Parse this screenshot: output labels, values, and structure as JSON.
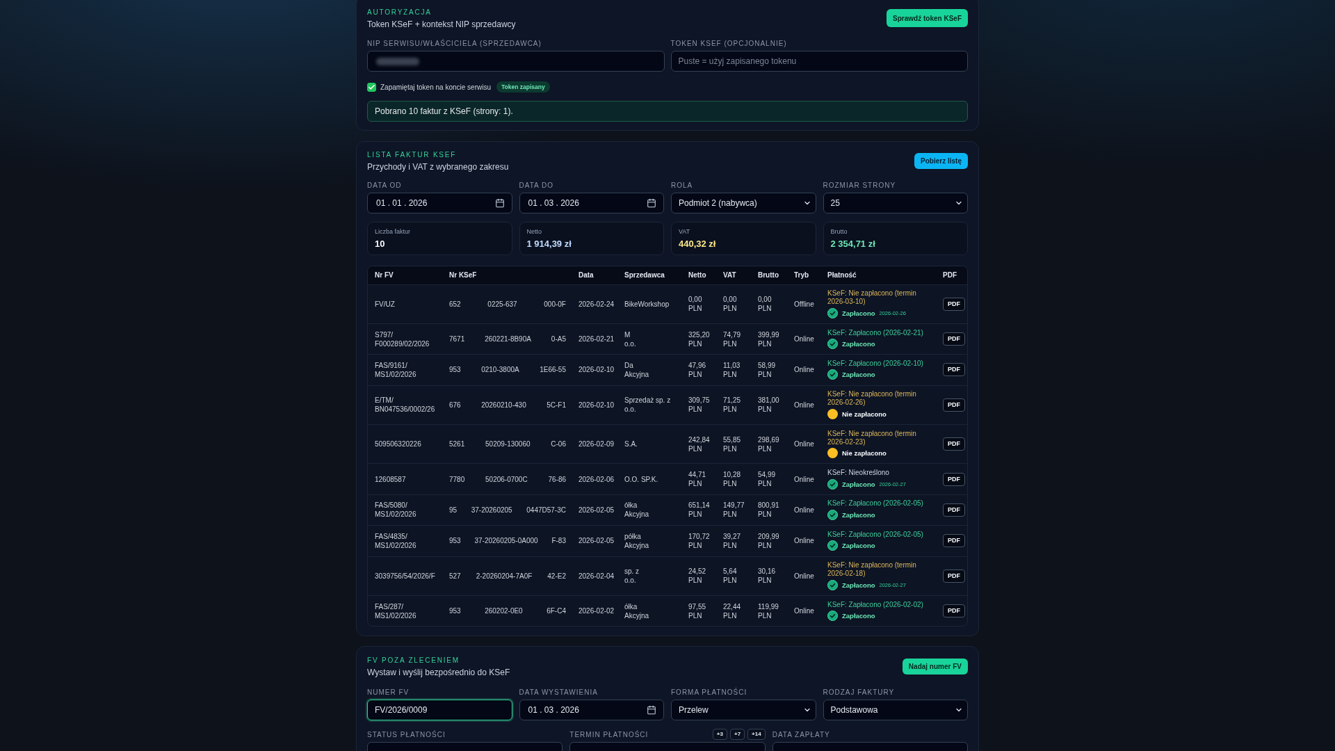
{
  "auth": {
    "section_label": "AUTORYZACJA",
    "subtitle": "Token KSeF + kontekst NIP sprzedawcy",
    "button": "Sprawdź token KSeF",
    "fields": [
      {
        "kind": "redacted",
        "label": "NIP SERWISU/WŁAŚCICIELA (SPRZEDAWCA)"
      },
      {
        "kind": "text",
        "label": "TOKEN KSEF (OPCJONALNIE)",
        "placeholder": "Puste = użyj zapisanego tokenu"
      }
    ],
    "remember": {
      "label": "Zapamiętaj token na koncie serwisu",
      "checked": true,
      "badge": "Token zapisany"
    },
    "message": "Pobrano 10 faktur z KSeF (strony: 1)."
  },
  "invoice_list": {
    "section_label": "LISTA FAKTUR KSEF",
    "subtitle": "Przychody i VAT z wybranego zakresu",
    "button": "Pobierz listę",
    "filters": [
      {
        "kind": "date",
        "label": "DATA OD",
        "value": "01 . 01 . 2026"
      },
      {
        "kind": "date",
        "label": "DATA DO",
        "value": "01 . 03 . 2026"
      },
      {
        "kind": "select",
        "label": "ROLA",
        "value": "Podmiot 2 (nabywca)"
      },
      {
        "kind": "select",
        "label": "ROZMIAR STRONY",
        "value": "25"
      }
    ],
    "stats": [
      {
        "label": "Liczba faktur",
        "value": "10",
        "color": "#f8fafc"
      },
      {
        "label": "Netto",
        "value": "1 914,39 zł",
        "color": "#bfdbfe"
      },
      {
        "label": "VAT",
        "value": "440,32 zł",
        "color": "#fde68a"
      },
      {
        "label": "Brutto",
        "value": "2 354,71 zł",
        "color": "#6ee7b7"
      }
    ],
    "table": {
      "columns": [
        "Nr FV",
        "Nr KSeF",
        "Data",
        "Sprzedawca",
        "Netto",
        "VAT",
        "Brutto",
        "Tryb",
        "Płatność",
        "PDF"
      ],
      "rows": [
        {
          "nr_fv": "FV/UZ",
          "ksef_number_parts": [
            "652",
            "0225-637",
            "000-0F"
          ],
          "date": "2026-02-24",
          "seller": "BikeWorkshop",
          "netto": "0,00 PLN",
          "vat": "0,00 PLN",
          "brutto": "0,00 PLN",
          "mode": "Offline",
          "ksef_status": {
            "kind": "unpaid",
            "text": "KSeF: Nie zapłacono (termin 2026-03-10)"
          },
          "payment": {
            "kind": "paid",
            "label": "Zapłacono",
            "date": "2026-02-26"
          },
          "pdf": "PDF"
        },
        {
          "nr_fv": "S797/F000289/02/2026",
          "ksef_number_parts": [
            "7671",
            "260221-8B90A",
            "0-A5"
          ],
          "date": "2026-02-21",
          "seller": "M\no.o.",
          "netto": "325,20 PLN",
          "vat": "74,79 PLN",
          "brutto": "399,99 PLN",
          "mode": "Online",
          "ksef_status": {
            "kind": "paid",
            "text": "KSeF: Zapłacono (2026-02-21)"
          },
          "payment": {
            "kind": "paid",
            "label": "Zapłacono"
          },
          "pdf": "PDF"
        },
        {
          "nr_fv": "FAS/9161/MS1/02/2026",
          "ksef_number_parts": [
            "953",
            "0210-3800A",
            "1E66-55"
          ],
          "date": "2026-02-10",
          "seller": "Da\nAkcyjna",
          "netto": "47,96 PLN",
          "vat": "11,03 PLN",
          "brutto": "58,99 PLN",
          "mode": "Online",
          "ksef_status": {
            "kind": "paid",
            "text": "KSeF: Zapłacono (2026-02-10)"
          },
          "payment": {
            "kind": "paid",
            "label": "Zapłacono"
          },
          "pdf": "PDF"
        },
        {
          "nr_fv": "E/TM/BN047536/0002/26",
          "ksef_number_parts": [
            "676",
            "20260210-430",
            "5C-F1"
          ],
          "date": "2026-02-10",
          "seller": "Sprzedaż sp. z\no.o.",
          "netto": "309,75 PLN",
          "vat": "71,25 PLN",
          "brutto": "381,00 PLN",
          "mode": "Online",
          "ksef_status": {
            "kind": "unpaid",
            "text": "KSeF: Nie zapłacono (termin 2026-02-26)"
          },
          "payment": {
            "kind": "unpaid",
            "label": "Nie zapłacono"
          },
          "pdf": "PDF"
        },
        {
          "nr_fv": "509506320226",
          "ksef_number_parts": [
            "5261",
            "50209-130060",
            "C-06"
          ],
          "date": "2026-02-09",
          "seller": "S.A.",
          "netto": "242,84 PLN",
          "vat": "55,85 PLN",
          "brutto": "298,69 PLN",
          "mode": "Online",
          "ksef_status": {
            "kind": "unpaid",
            "text": "KSeF: Nie zapłacono (termin 2026-02-23)"
          },
          "payment": {
            "kind": "unpaid",
            "label": "Nie zapłacono"
          },
          "pdf": "PDF"
        },
        {
          "nr_fv": "12608587",
          "ksef_number_parts": [
            "7780",
            "50206-0700C",
            "76-86"
          ],
          "date": "2026-02-06",
          "seller": "O.O. SP.K.",
          "netto": "44,71 PLN",
          "vat": "10,28 PLN",
          "brutto": "54,99 PLN",
          "mode": "Online",
          "ksef_status": {
            "kind": "unknown",
            "text": "KSeF: Nieokreślono"
          },
          "payment": {
            "kind": "paid",
            "label": "Zapłacono",
            "date": "2026-02-27"
          },
          "pdf": "PDF"
        },
        {
          "nr_fv": "FAS/5080/MS1/02/2026",
          "ksef_number_parts": [
            "95",
            "37-20260205",
            "0447D57-3C"
          ],
          "date": "2026-02-05",
          "seller": "ółka\nAkcyjna",
          "netto": "651,14 PLN",
          "vat": "149,77 PLN",
          "brutto": "800,91 PLN",
          "mode": "Online",
          "ksef_status": {
            "kind": "paid",
            "text": "KSeF: Zapłacono (2026-02-05)"
          },
          "payment": {
            "kind": "paid",
            "label": "Zapłacono"
          },
          "pdf": "PDF"
        },
        {
          "nr_fv": "FAS/4835/MS1/02/2026",
          "ksef_number_parts": [
            "953",
            "37-20260205-0A000",
            "F-83"
          ],
          "date": "2026-02-05",
          "seller": "półka\nAkcyjna",
          "netto": "170,72 PLN",
          "vat": "39,27 PLN",
          "brutto": "209,99 PLN",
          "mode": "Online",
          "ksef_status": {
            "kind": "paid",
            "text": "KSeF: Zapłacono (2026-02-05)"
          },
          "payment": {
            "kind": "paid",
            "label": "Zapłacono"
          },
          "pdf": "PDF"
        },
        {
          "nr_fv": "3039756/54/2026/F",
          "ksef_number_parts": [
            "527",
            "2-20260204-7A0F",
            "42-E2"
          ],
          "date": "2026-02-04",
          "seller": "sp. z\no.o.",
          "netto": "24,52 PLN",
          "vat": "5,64 PLN",
          "brutto": "30,16 PLN",
          "mode": "Online",
          "ksef_status": {
            "kind": "unpaid",
            "text": "KSeF: Nie zapłacono (termin 2026-02-18)"
          },
          "payment": {
            "kind": "paid",
            "label": "Zapłacono",
            "date": "2026-02-27"
          },
          "pdf": "PDF"
        },
        {
          "nr_fv": "FAS/287/MS1/02/2026",
          "ksef_number_parts": [
            "953",
            "260202-0E0",
            "6F-C4"
          ],
          "date": "2026-02-02",
          "seller": "ółka\nAkcyjna",
          "netto": "97,55 PLN",
          "vat": "22,44 PLN",
          "brutto": "119,99 PLN",
          "mode": "Online",
          "ksef_status": {
            "kind": "paid",
            "text": "KSeF: Zapłacono (2026-02-02)"
          },
          "payment": {
            "kind": "paid",
            "label": "Zapłacono"
          },
          "pdf": "PDF"
        }
      ]
    }
  },
  "new_invoice": {
    "section_label": "FV POZA ZLECENIEM",
    "subtitle": "Wystaw i wyślij bezpośrednio do KSeF",
    "button": "Nadaj numer FV",
    "fields": [
      {
        "kind": "text",
        "label": "NUMER FV",
        "value": "FV/2026/0009",
        "focused": true
      },
      {
        "kind": "date",
        "label": "DATA WYSTAWIENIA",
        "value": "01 . 03 . 2026",
        "focused": false
      },
      {
        "kind": "select",
        "label": "FORMA PŁATNOŚCI",
        "value": "Przelew",
        "focused": false
      },
      {
        "kind": "select",
        "label": "RODZAJ FAKTURY",
        "value": "Podstawowa",
        "focused": false
      }
    ],
    "fields_row_2": [
      {
        "label": "STATUS PŁATNOŚCI"
      },
      {
        "label": "TERMIN PŁATNOŚCI",
        "quick_buttons": [
          "+3",
          "+7",
          "+14"
        ]
      },
      {
        "label": "DATA ZAPŁATY"
      }
    ]
  }
}
